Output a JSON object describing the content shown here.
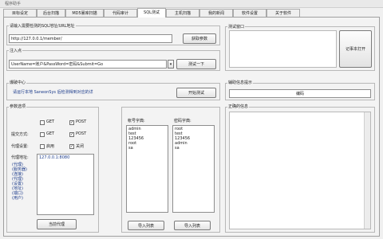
{
  "window": {
    "title": "程序助手"
  },
  "tabs": [
    "目标设定",
    "后台扫描",
    "MD5暴库扫描",
    "代码审计",
    "SQL测试",
    "主机扫描",
    "我的新闻",
    "软件设置",
    "关于软件"
  ],
  "target": {
    "label": "请输入需要检测的SQL地址/URL地址",
    "value": "http://127.0.0.1/member/",
    "button": "获取参数"
  },
  "injection": {
    "label": "注入点",
    "value": "UserName=账户&PassWord=密码&Submit=Go",
    "dropdown_arrow": "▾",
    "button": "测试一下"
  },
  "result_window": {
    "label": "测试窗口",
    "button": "记事本打开"
  },
  "crack_center": {
    "label": "爆破中心",
    "link_text": "请运行本地 SaneonSys 后检测得到对应的详",
    "button": "开始测试"
  },
  "aux_info": {
    "label": "辅助信息提示",
    "value": "编码"
  },
  "params": {
    "label": "参数选项",
    "row1": {
      "label": "",
      "opt1": "GET",
      "opt2": "POST"
    },
    "row2": {
      "label": "提交方式:",
      "opt1": "GET",
      "opt2": "POST"
    },
    "row3": {
      "label": "代理设置:",
      "opt1": "启用",
      "opt2": "关闭"
    },
    "proxy_label": "代理地址:",
    "proxy_list": [
      "127.0.0.1:8080",
      "(代理)",
      "(服务器)",
      "(连接)",
      "(代理)",
      "(设置)",
      "(地址)",
      "(端口)",
      "(用户)"
    ],
    "proxy_button": "当前代理"
  },
  "dict": {
    "user_label": "帐号字典:",
    "user_items": [
      "admin",
      "test",
      "123456",
      "root",
      "sa"
    ],
    "pass_label": "密码字典:",
    "pass_items": [
      "root",
      "test",
      "123456",
      "admin",
      "sa"
    ],
    "user_button": "导入列表",
    "pass_button": "导入列表"
  },
  "log": {
    "label": "正确的信息"
  }
}
